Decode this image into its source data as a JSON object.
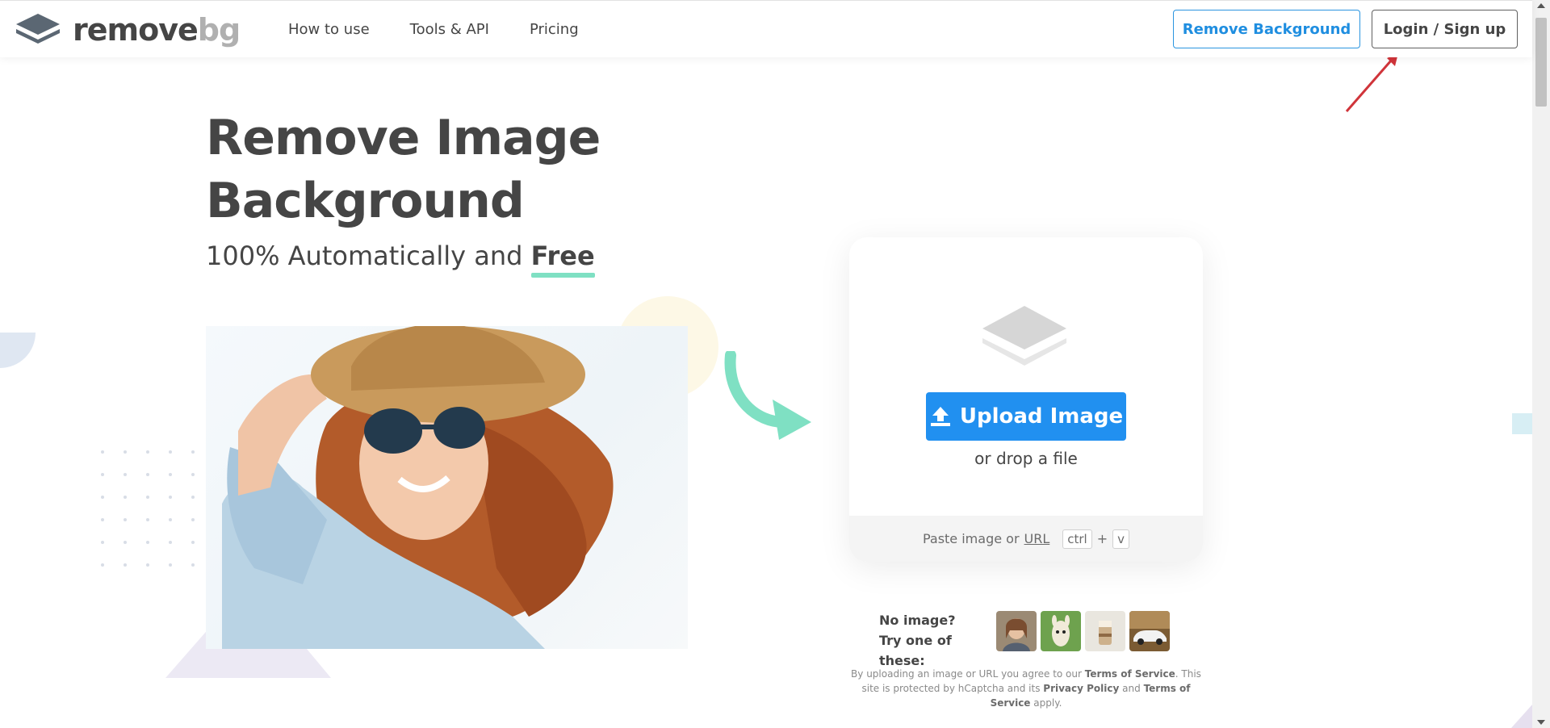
{
  "header": {
    "logo": {
      "remove": "remove",
      "bg": "bg"
    },
    "nav": [
      "How to use",
      "Tools & API",
      "Pricing"
    ],
    "remove_background_button": "Remove Background",
    "login_button": "Login / Sign up"
  },
  "hero": {
    "title_line1": "Remove Image",
    "title_line2": "Background",
    "subtitle_prefix": "100% Automatically and",
    "subtitle_emphasis": "Free"
  },
  "upload": {
    "button_label": "Upload Image",
    "drop_text": "or drop a file",
    "paste_prefix": "Paste image or",
    "paste_url": "URL",
    "kbd_ctrl": "ctrl",
    "kbd_plus": "+",
    "kbd_v": "v"
  },
  "samples": {
    "line1": "No image?",
    "line2": "Try one of these:"
  },
  "legal": {
    "part1": "By uploading an image or URL you agree to our",
    "terms": "Terms of Service",
    "part2": ". This site is protected by hCaptcha and its",
    "privacy": "Privacy Policy",
    "and": "and",
    "terms2": "Terms of Service",
    "apply": "apply."
  },
  "colors": {
    "brand_blue": "#2190f0",
    "text_dark": "#454545",
    "accent_green": "#7fe0c3",
    "annotation_red": "#d0343a"
  },
  "icons": [
    "layers-logo-icon",
    "upload-arrow-icon",
    "layers-upload-icon",
    "curved-arrow-icon"
  ]
}
